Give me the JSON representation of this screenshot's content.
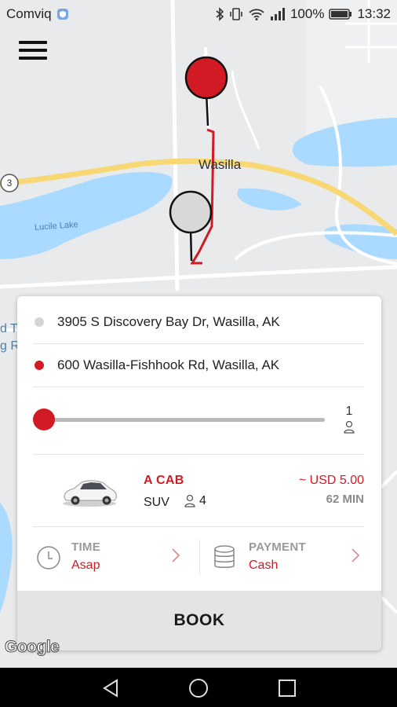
{
  "status_bar": {
    "carrier": "Comviq",
    "battery": "100%",
    "time": "13:32",
    "icons": [
      "bluetooth-icon",
      "vibrate-icon",
      "wifi-icon",
      "signal-icon",
      "battery-icon"
    ]
  },
  "map": {
    "town_label": "Wasilla",
    "lake_label": "Lucile Lake",
    "route_shield": "3",
    "left_edge_text": [
      "d T",
      "g Ra"
    ],
    "colors": {
      "water": "#aadaff",
      "land": "#e8eaec",
      "road": "#ffffff",
      "highway": "#f8d874",
      "route": "#d11a24"
    },
    "pickup_pin_color": "#d11a24",
    "dropoff_pin_color": "#d8d8d8"
  },
  "booking": {
    "pickup_address": "3905 S Discovery Bay Dr, Wasilla, AK",
    "dropoff_address": "600 Wasilla-Fishhook Rd, Wasilla, AK",
    "pickup_dot_color": "#d5d5d5",
    "dropoff_dot_color": "#d11a24",
    "passengers": "1",
    "passenger_slider_fraction": 0,
    "vehicle": {
      "name": "A CAB",
      "type": "SUV",
      "seats": "4",
      "price": "~ USD 5.00",
      "eta": "62 MIN"
    },
    "time_option": {
      "label": "TIME",
      "value": "Asap"
    },
    "payment_option": {
      "label": "PAYMENT",
      "value": "Cash"
    },
    "book_label": "BOOK"
  },
  "footer": {
    "google_logo": "Google"
  },
  "nav_bar": {
    "buttons": [
      "back-icon",
      "home-icon",
      "recents-icon"
    ]
  }
}
